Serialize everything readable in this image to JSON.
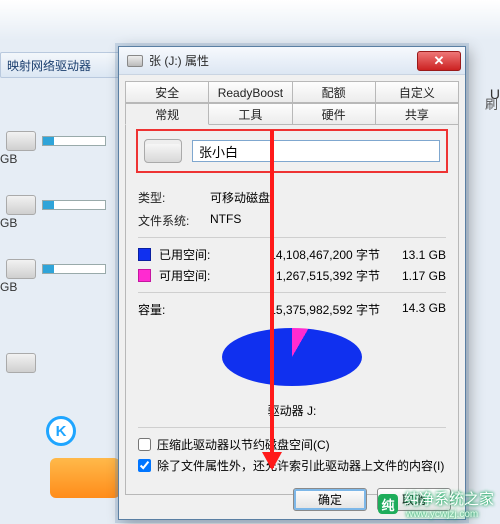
{
  "background": {
    "toolbar_btn": "映射网络驱动器",
    "gb_label": "GB",
    "u_label": "U",
    "brush_label": "刷",
    "k_label": "K"
  },
  "dialog": {
    "title": "张 (J:) 属性",
    "close": "✕",
    "tabs_row1": [
      "安全",
      "ReadyBoost",
      "配额",
      "自定义"
    ],
    "tabs_row2": [
      "常规",
      "工具",
      "硬件",
      "共享"
    ],
    "name_value": "张小白",
    "type_label": "类型:",
    "type_value": "可移动磁盘",
    "fs_label": "文件系统:",
    "fs_value": "NTFS",
    "used_label": "已用空间:",
    "used_bytes": "14,108,467,200 字节",
    "used_gb": "13.1 GB",
    "free_label": "可用空间:",
    "free_bytes": "1,267,515,392 字节",
    "free_gb": "1.17 GB",
    "cap_label": "容量:",
    "cap_bytes": "15,375,982,592 字节",
    "cap_gb": "14.3 GB",
    "drive_label": "驱动器 J:",
    "compress_label": "压缩此驱动器以节约磁盘空间(C)",
    "index_label": "除了文件属性外，还允许索引此驱动器上文件的内容(I)",
    "ok": "确定",
    "cancel": "取消"
  },
  "watermark": {
    "logo": "纯",
    "text": "纯净系统之家",
    "url": "www.ycwjzj.com"
  },
  "chart_data": {
    "type": "pie",
    "title": "驱动器 J:",
    "series": [
      {
        "name": "已用空间",
        "value": 14108467200,
        "display": "13.1 GB",
        "color": "#1030ef"
      },
      {
        "name": "可用空间",
        "value": 1267515392,
        "display": "1.17 GB",
        "color": "#ff2bd0"
      }
    ],
    "total": {
      "value": 15375982592,
      "display": "14.3 GB"
    }
  }
}
